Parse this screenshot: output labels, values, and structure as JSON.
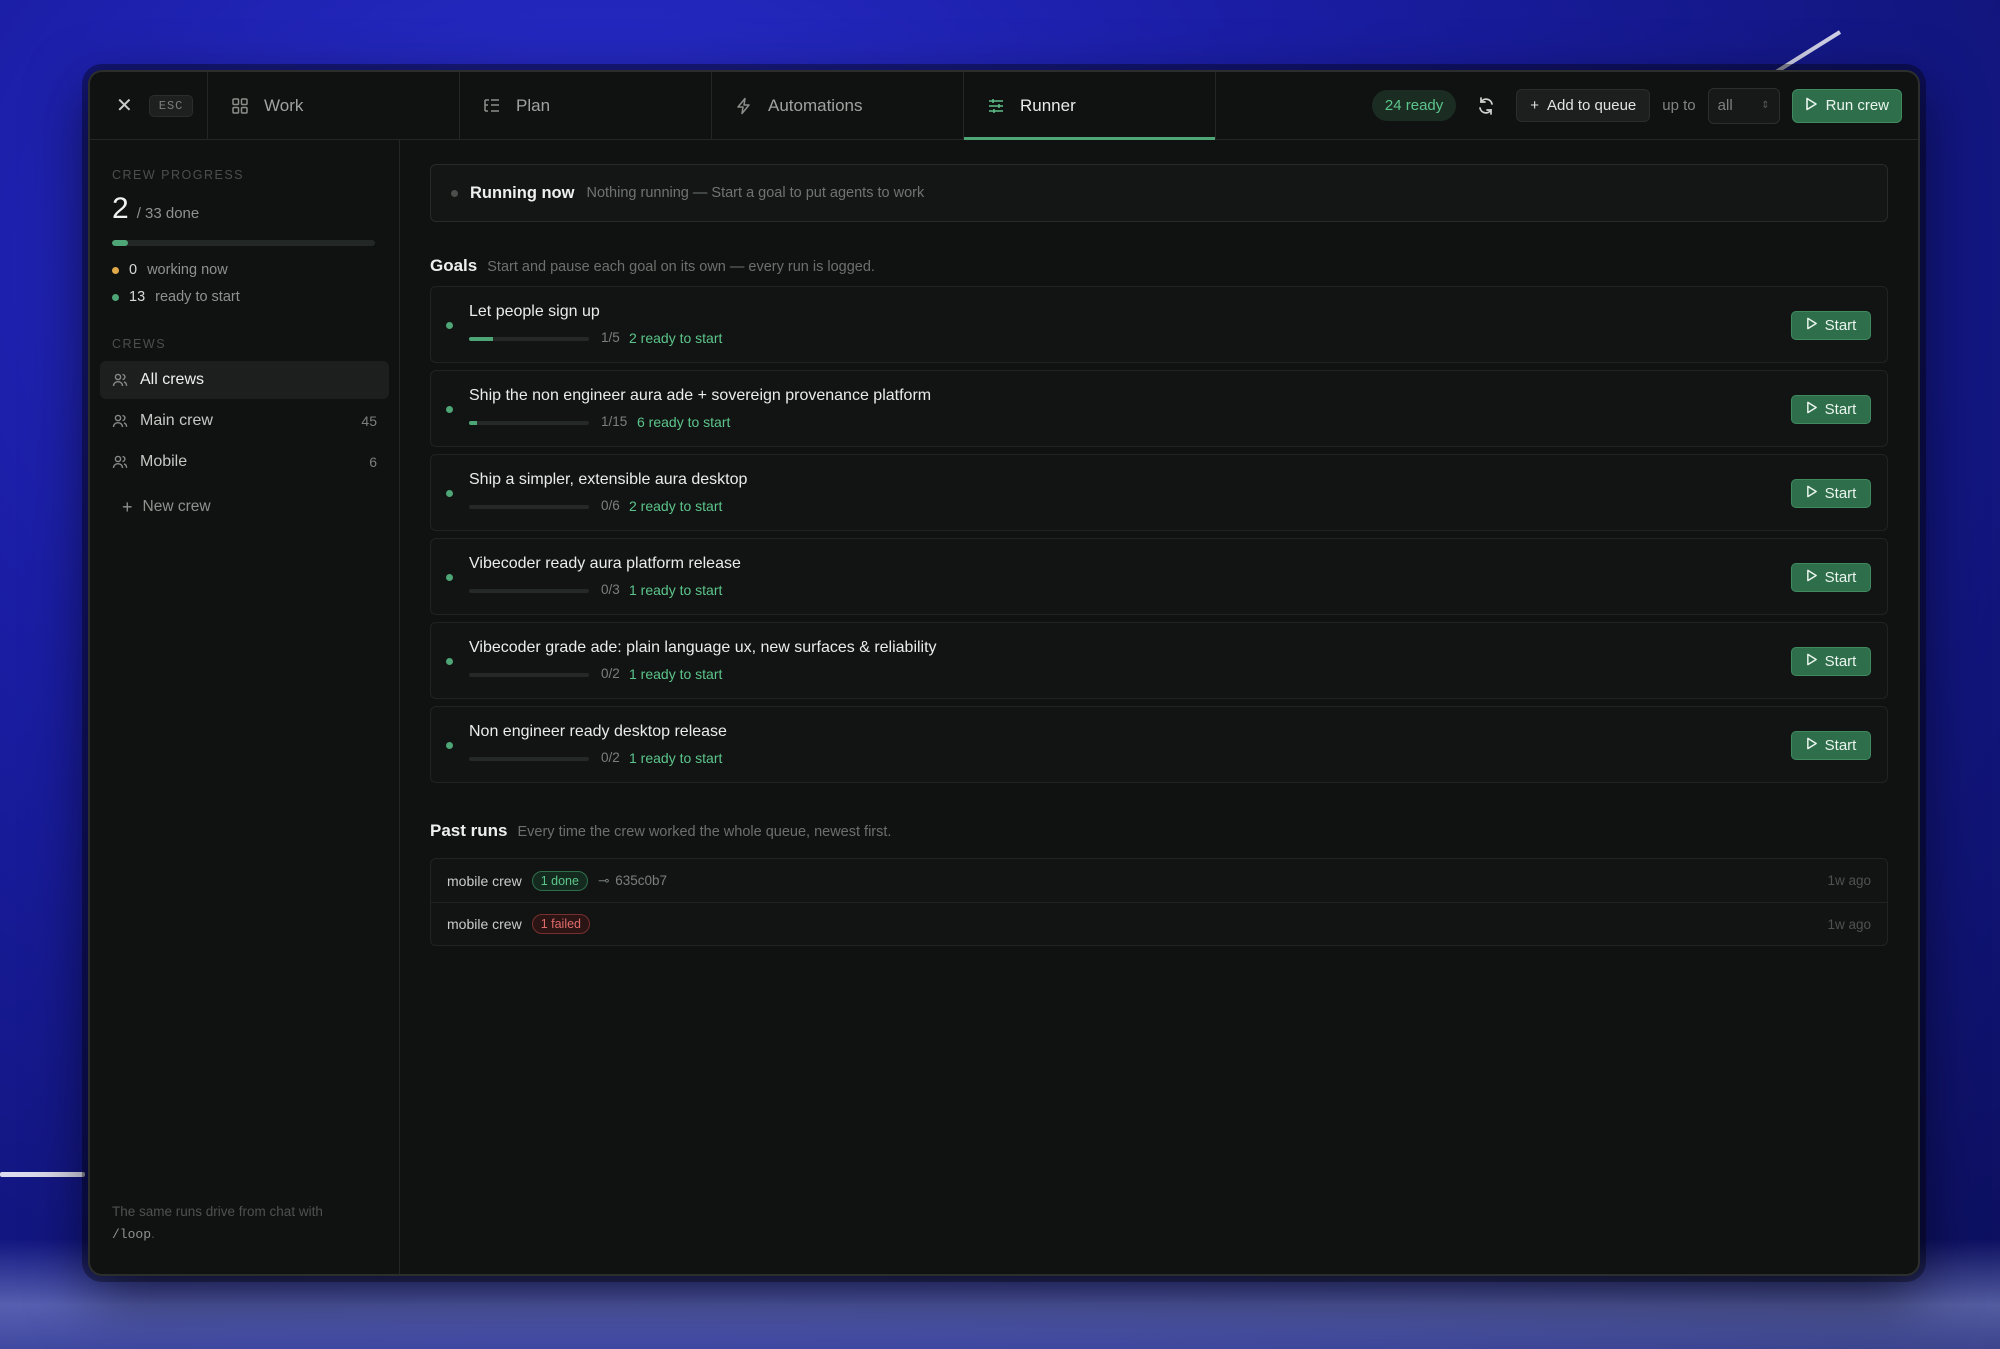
{
  "topbar": {
    "close_key": "ESC",
    "tabs": [
      {
        "label": "Work",
        "icon": "grid-icon",
        "active": false
      },
      {
        "label": "Plan",
        "icon": "list-tree-icon",
        "active": false
      },
      {
        "label": "Automations",
        "icon": "lightning-icon",
        "active": false
      },
      {
        "label": "Runner",
        "icon": "sliders-icon",
        "active": true
      }
    ],
    "ready_badge": "24 ready",
    "add_queue_label": "Add to queue",
    "upto_label": "up to",
    "upto_value": "all",
    "run_crew_label": "Run crew"
  },
  "sidebar": {
    "progress_label": "CREW PROGRESS",
    "done_count": "2",
    "done_total": "/ 33 done",
    "progress_fraction": 0.0606,
    "working_count": "0",
    "working_label": "working now",
    "ready_count": "13",
    "ready_label": "ready to start",
    "crews_label": "CREWS",
    "crews": [
      {
        "name": "All crews",
        "count": "",
        "active": true
      },
      {
        "name": "Main crew",
        "count": "45",
        "active": false
      },
      {
        "name": "Mobile",
        "count": "6",
        "active": false
      }
    ],
    "new_crew_label": "New crew",
    "footer_text": "The same runs drive from chat with",
    "footer_code": "/loop",
    "footer_end": "."
  },
  "running": {
    "title": "Running now",
    "subtitle": "Nothing running — Start a goal to put agents to work"
  },
  "goals": {
    "heading": "Goals",
    "subheading": "Start and pause each goal on its own — every run is logged.",
    "start_label": "Start",
    "items": [
      {
        "title": "Let people sign up",
        "fraction": "1/5",
        "done": 1,
        "total": 5,
        "ready": "2 ready to start"
      },
      {
        "title": "Ship the non engineer aura ade + sovereign provenance platform",
        "fraction": "1/15",
        "done": 1,
        "total": 15,
        "ready": "6 ready to start"
      },
      {
        "title": "Ship a simpler, extensible aura desktop",
        "fraction": "0/6",
        "done": 0,
        "total": 6,
        "ready": "2 ready to start"
      },
      {
        "title": "Vibecoder ready aura platform release",
        "fraction": "0/3",
        "done": 0,
        "total": 3,
        "ready": "1 ready to start"
      },
      {
        "title": "Vibecoder grade ade: plain language ux, new surfaces & reliability",
        "fraction": "0/2",
        "done": 0,
        "total": 2,
        "ready": "1 ready to start"
      },
      {
        "title": "Non engineer ready desktop release",
        "fraction": "0/2",
        "done": 0,
        "total": 2,
        "ready": "1 ready to start"
      }
    ]
  },
  "past_runs": {
    "heading": "Past runs",
    "subheading": "Every time the crew worked the whole queue, newest first.",
    "items": [
      {
        "crew": "mobile crew",
        "status": "1 done",
        "status_type": "done",
        "commit": "635c0b7",
        "ago": "1w ago"
      },
      {
        "crew": "mobile crew",
        "status": "1 failed",
        "status_type": "failed",
        "commit": "",
        "ago": "1w ago"
      }
    ]
  },
  "colors": {
    "accent": "#4ea677",
    "accent_text": "#5cc58b",
    "working_dot": "#e0a94a",
    "ready_dot": "#4ea677",
    "fail": "#e06b6b"
  }
}
